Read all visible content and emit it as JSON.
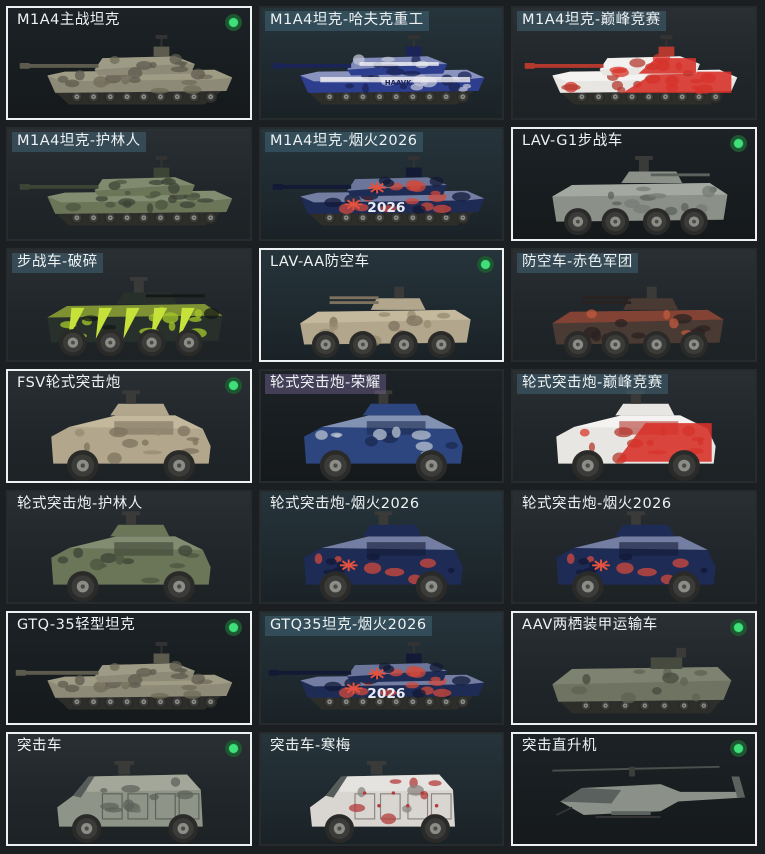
{
  "vehicles": [
    {
      "name": "M1A4主战坦克",
      "owned": true,
      "kind": "tank",
      "skin": "desert",
      "tag": false
    },
    {
      "name": "M1A4坦克-哈夫克重工",
      "owned": false,
      "kind": "tank",
      "skin": "haavk",
      "tag": true
    },
    {
      "name": "M1A4坦克-巅峰竞赛",
      "owned": false,
      "kind": "tank",
      "skin": "race",
      "tag": true
    },
    {
      "name": "M1A4坦克-护林人",
      "owned": false,
      "kind": "tank",
      "skin": "woodland",
      "tag": true
    },
    {
      "name": "M1A4坦克-烟火2026",
      "owned": false,
      "kind": "tank",
      "skin": "fireworks",
      "tag": true
    },
    {
      "name": "LAV-G1步战车",
      "owned": true,
      "kind": "ifv",
      "skin": "grey",
      "tag": false
    },
    {
      "name": "步战车-破碎",
      "owned": false,
      "kind": "ifv",
      "skin": "shatter",
      "tag": true
    },
    {
      "name": "LAV-AA防空车",
      "owned": true,
      "kind": "aa",
      "skin": "sand",
      "tag": false
    },
    {
      "name": "防空车-赤色军团",
      "owned": false,
      "kind": "aa",
      "skin": "redcamo",
      "tag": true
    },
    {
      "name": "FSV轮式突击炮",
      "owned": true,
      "kind": "fsv",
      "skin": "sand",
      "tag": false
    },
    {
      "name": "轮式突击炮-荣耀",
      "owned": false,
      "kind": "fsv",
      "skin": "glory",
      "tag": "purple"
    },
    {
      "name": "轮式突击炮-巅峰竞赛",
      "owned": false,
      "kind": "fsv",
      "skin": "race",
      "tag": true
    },
    {
      "name": "轮式突击炮-护林人",
      "owned": false,
      "kind": "fsv",
      "skin": "woodland",
      "tag": false
    },
    {
      "name": "轮式突击炮-烟火2026",
      "owned": false,
      "kind": "fsv",
      "skin": "fireworks",
      "tag": false
    },
    {
      "name": "轮式突击炮-烟火2026",
      "owned": false,
      "kind": "fsv",
      "skin": "fireworks",
      "tag": false
    },
    {
      "name": "GTQ-35轻型坦克",
      "owned": true,
      "kind": "light",
      "skin": "desert",
      "tag": false
    },
    {
      "name": "GTQ35坦克-烟火2026",
      "owned": false,
      "kind": "light",
      "skin": "fireworks",
      "tag": true
    },
    {
      "name": "AAV两栖装甲运输车",
      "owned": true,
      "kind": "aav",
      "skin": "olive",
      "tag": false
    },
    {
      "name": "突击车",
      "owned": true,
      "kind": "mrap",
      "skin": "greycamo",
      "tag": false
    },
    {
      "name": "突击车-寒梅",
      "owned": false,
      "kind": "mrap",
      "skin": "plum",
      "tag": false
    },
    {
      "name": "突击直升机",
      "owned": true,
      "kind": "heli",
      "skin": "grey",
      "tag": false
    }
  ],
  "skin_number": "2026",
  "haavk_text": "HAAVK",
  "colors": {
    "owned_border": "#eef1f2",
    "owned_dot": "#3fe07a",
    "card_bg": "#262b2e",
    "name_text": "#eef2f3"
  }
}
